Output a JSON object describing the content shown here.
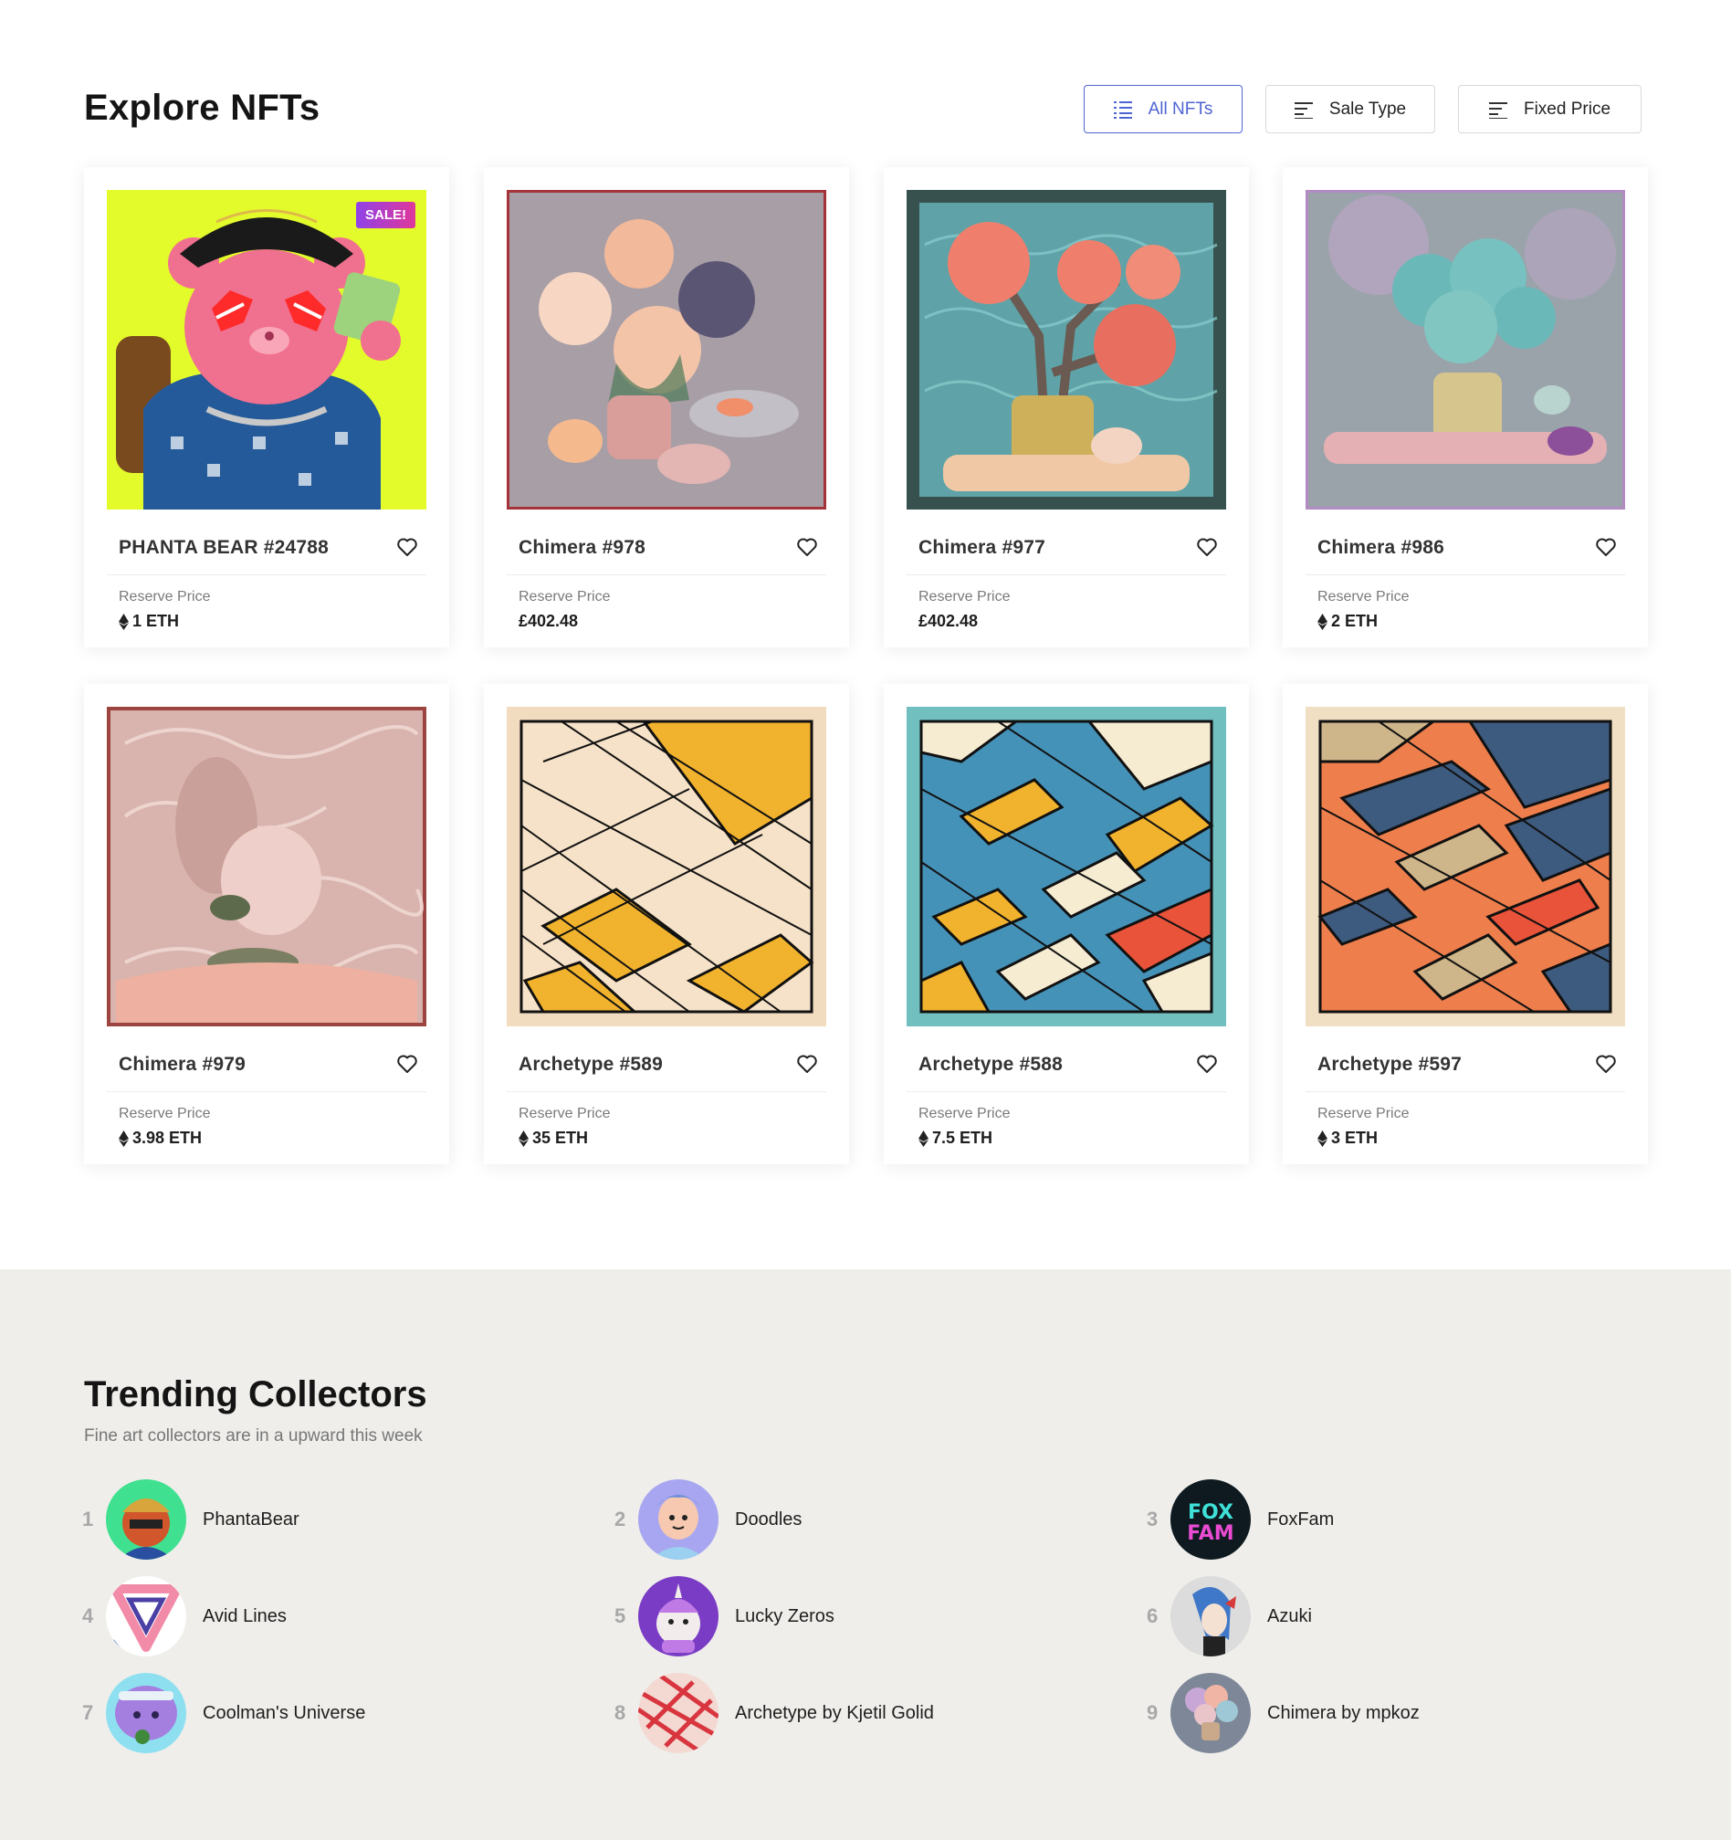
{
  "explore": {
    "title": "Explore NFTs",
    "filters": {
      "all": "All NFTs",
      "sale_type": "Sale Type",
      "fixed_price": "Fixed Price"
    },
    "price_label": "Reserve Price",
    "items": [
      {
        "name": "PHANTA BEAR #24788",
        "price": "1 ETH",
        "currency": "eth",
        "badge": "SALE!"
      },
      {
        "name": "Chimera #978",
        "price": "£402.48",
        "currency": "gbp"
      },
      {
        "name": "Chimera #977",
        "price": "£402.48",
        "currency": "gbp"
      },
      {
        "name": "Chimera #986",
        "price": "2 ETH",
        "currency": "eth"
      },
      {
        "name": "Chimera #979",
        "price": "3.98 ETH",
        "currency": "eth"
      },
      {
        "name": "Archetype #589",
        "price": "35 ETH",
        "currency": "eth"
      },
      {
        "name": "Archetype #588",
        "price": "7.5 ETH",
        "currency": "eth"
      },
      {
        "name": "Archetype #597",
        "price": "3 ETH",
        "currency": "eth"
      }
    ]
  },
  "trending": {
    "title": "Trending Collectors",
    "subtitle": "Fine art collectors are in a upward this week",
    "collectors": [
      {
        "rank": "1",
        "name": "PhantaBear"
      },
      {
        "rank": "2",
        "name": "Doodles"
      },
      {
        "rank": "3",
        "name": "FoxFam",
        "avatar_text": "FOX FAM"
      },
      {
        "rank": "4",
        "name": "Avid Lines"
      },
      {
        "rank": "5",
        "name": "Lucky Zeros"
      },
      {
        "rank": "6",
        "name": "Azuki"
      },
      {
        "rank": "7",
        "name": "Coolman's Universe"
      },
      {
        "rank": "8",
        "name": "Archetype by Kjetil Golid"
      },
      {
        "rank": "9",
        "name": "Chimera by mpkoz"
      }
    ]
  },
  "colors": {
    "accent": "#4f64d3",
    "trending_bg": "#efeeeb",
    "sale_badge_from": "#8f42e8",
    "sale_badge_to": "#e0379a"
  },
  "icons": {
    "filter_all": "list-icon",
    "filter_other": "sort-lines-icon",
    "favorite": "heart-icon",
    "currency": "ethereum-icon"
  }
}
